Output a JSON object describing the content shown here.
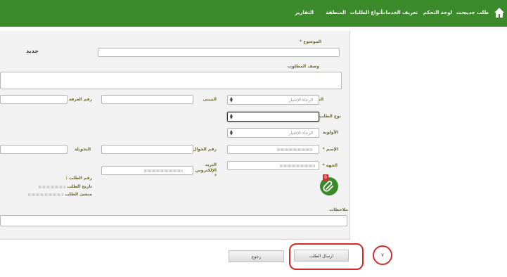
{
  "nav": {
    "items": [
      "طلب جديد",
      "بحث",
      "لوحة التحكم",
      "تعريف الخدمات",
      "أنواع الطلبات",
      "المنطقة",
      "التقارير"
    ]
  },
  "form": {
    "header_title": "جديد",
    "subject_label": "الموضوع *",
    "description_label": "وصف المطلوب",
    "region_label": "المنطقة *",
    "region_value": "الرجاء الإختيار",
    "building_label": "المبنى",
    "room_label": "رقم الغرفة",
    "request_type_label": "نوع الطلب *",
    "request_type_value": "",
    "priority_label": "الأولوية",
    "priority_value": "الرجاء الإختيار",
    "name_label": "الإسم *",
    "mobile_label": "رقم الجوال *",
    "extension_label": "التحويلة",
    "department_label": "الجهة *",
    "email_label": "البريد الإلكتروني *",
    "request_no_label": "رقم الطلب :",
    "request_date_label": "تاريخ الطلب",
    "request_creator_label": "منشئ الطلب",
    "notes_label": "ملاحظات",
    "attachment_count": "0"
  },
  "actions": {
    "submit_label": "ارسال الطلب",
    "back_label": "رجوع",
    "step_marker": "٧"
  },
  "colors": {
    "topbar": "#3d8a2c",
    "label": "#6b6a2a",
    "highlight": "#d42a2a"
  }
}
